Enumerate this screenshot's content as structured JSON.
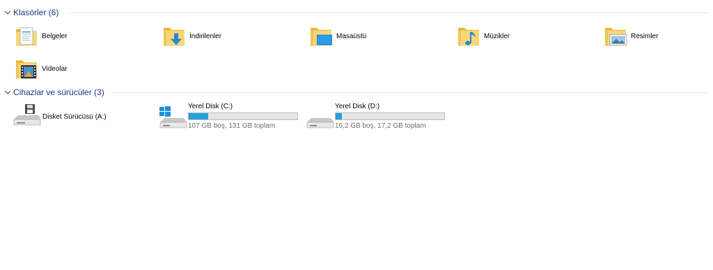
{
  "groups": {
    "folders": {
      "title": "Klasörler (6)"
    },
    "devices": {
      "title": "Cihazlar ve sürücüler (3)"
    }
  },
  "folders": [
    {
      "label": "Belgeler",
      "icon": "documents-folder-icon"
    },
    {
      "label": "İndirilenler",
      "icon": "downloads-folder-icon"
    },
    {
      "label": "Masaüstü",
      "icon": "desktop-folder-icon"
    },
    {
      "label": "Müzikler",
      "icon": "music-folder-icon"
    },
    {
      "label": "Resimler",
      "icon": "pictures-folder-icon"
    },
    {
      "label": "Videolar",
      "icon": "videos-folder-icon"
    }
  ],
  "devices": [
    {
      "label": "Disket Sürücüsü (A:)",
      "icon": "floppy-drive-icon"
    },
    {
      "label": "Yerel Disk (C:)",
      "icon": "windows-drive-icon",
      "status": "107 GB boş, 131 GB toplam",
      "used_fraction": 0.18
    },
    {
      "label": "Yerel Disk (D:)",
      "icon": "hard-drive-icon",
      "status": "16,2 GB boş, 17,2 GB toplam",
      "used_fraction": 0.06
    }
  ],
  "colors": {
    "group_header": "#1e3287",
    "usage_bar": "#26a0da",
    "folder_yellow": "#f8d775"
  }
}
